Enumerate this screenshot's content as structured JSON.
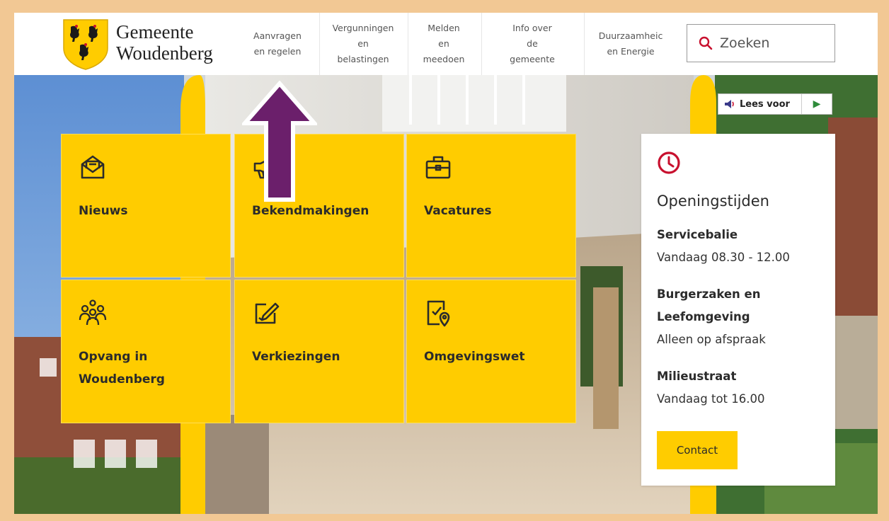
{
  "logo": {
    "line1": "Gemeente",
    "line2": "Woudenberg"
  },
  "nav": [
    {
      "label": "Aanvragen\nen regelen"
    },
    {
      "label": "Vergunningen\nen\nbelastingen"
    },
    {
      "label": "Melden\nen\nmeedoen"
    },
    {
      "label": "Info over\nde\ngemeente"
    },
    {
      "label": "Duurzaamheic\nen Energie"
    }
  ],
  "search": {
    "placeholder": "Zoeken",
    "icon": "search-icon"
  },
  "lees_voor": {
    "label": "Lees voor",
    "icon": "speaker-icon",
    "play_icon": "play-icon"
  },
  "tiles": [
    {
      "label": "Nieuws",
      "icon": "newsletter-icon"
    },
    {
      "label": "Bekendmakingen",
      "icon": "megaphone-icon"
    },
    {
      "label": "Vacatures",
      "icon": "briefcase-icon"
    },
    {
      "label": "Opvang in Woudenberg",
      "icon": "people-group-icon"
    },
    {
      "label": "Verkiezingen",
      "icon": "ballot-pencil-icon"
    },
    {
      "label": "Omgevingswet",
      "icon": "document-location-icon"
    }
  ],
  "opening_hours": {
    "icon": "clock-icon",
    "title": "Openingstijden",
    "sections": [
      {
        "title": "Servicebalie",
        "text": "Vandaag 08.30 - 12.00"
      },
      {
        "title": "Burgerzaken en Leefomgeving",
        "text": "Alleen op afspraak"
      },
      {
        "title": "Milieustraat",
        "text": "Vandaag tot 16.00"
      }
    ],
    "button": "Contact"
  },
  "colors": {
    "accent": "#ffcc00",
    "clock": "#c8102e",
    "arrow": "#6b1f6b",
    "frame": "#f2c894"
  }
}
